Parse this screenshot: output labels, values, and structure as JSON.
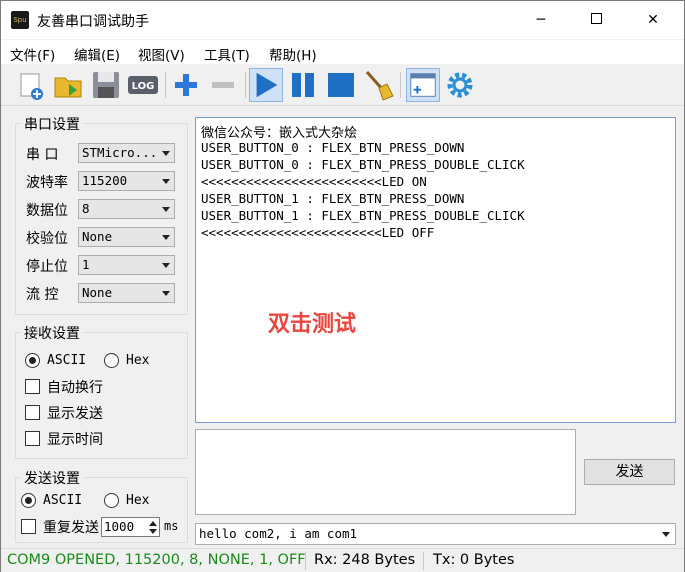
{
  "window": {
    "title": "友善串口调试助手",
    "icon_text": "Spu",
    "min_glyph": "─",
    "close_glyph": "✕"
  },
  "menu": {
    "items": [
      "文件(F)",
      "编辑(E)",
      "视图(V)",
      "工具(T)",
      "帮助(H)"
    ]
  },
  "toolbar": {
    "log_label": "LOG"
  },
  "serial_settings": {
    "title": "串口设置",
    "port_label": "串  口",
    "port_value": "STMicro...",
    "baud_label": "波特率",
    "baud_value": "115200",
    "databits_label": "数据位",
    "databits_value": "8",
    "parity_label": "校验位",
    "parity_value": "None",
    "stopbits_label": "停止位",
    "stopbits_value": "1",
    "flow_label": "流  控",
    "flow_value": "None"
  },
  "receive_settings": {
    "title": "接收设置",
    "ascii_label": "ASCII",
    "hex_label": "Hex",
    "auto_wrap_label": "自动换行",
    "show_send_label": "显示发送",
    "show_time_label": "显示时间"
  },
  "send_settings": {
    "title": "发送设置",
    "ascii_label": "ASCII",
    "hex_label": "Hex",
    "repeat_label": "重复发送",
    "repeat_interval": "1000",
    "unit": "ms"
  },
  "receive_area": {
    "lines": [
      "微信公众号：嵌入式大杂烩",
      "USER_BUTTON_0 : FLEX_BTN_PRESS_DOWN",
      "USER_BUTTON_0 : FLEX_BTN_PRESS_DOUBLE_CLICK",
      "<<<<<<<<<<<<<<<<<<<<<<<<LED ON",
      "USER_BUTTON_1 : FLEX_BTN_PRESS_DOWN",
      "USER_BUTTON_1 : FLEX_BTN_PRESS_DOUBLE_CLICK",
      "<<<<<<<<<<<<<<<<<<<<<<<<LED OFF"
    ],
    "overlay_text": "双击测试"
  },
  "send_area": {
    "send_button": "发送",
    "history_value": "hello com2, i am com1"
  },
  "status": {
    "port_status": "COM9 OPENED, 115200, 8, NONE, 1, OFF",
    "rx": "Rx: 248 Bytes",
    "tx": "Tx: 0 Bytes"
  },
  "colors": {
    "status_ok": "#1a8a1a",
    "accent": "#e8473f",
    "toolbar_blue": "#1f6fc5"
  }
}
